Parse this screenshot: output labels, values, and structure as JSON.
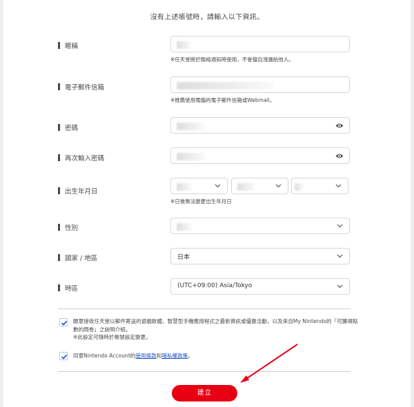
{
  "intro": "沒有上述帳號時，請輸入以下資訊。",
  "fields": {
    "nickname": {
      "label": "暱稱",
      "hint": "※任天堂將於聯絡通知時使用，不會擅自洩漏給他人。"
    },
    "email": {
      "label": "電子郵件信箱",
      "hint": "※推薦使用電腦的電子郵件信箱或Webmail。"
    },
    "password": {
      "label": "密碼"
    },
    "password_confirm": {
      "label": "再次輸入密碼"
    },
    "birthday": {
      "label": "出生年月日",
      "hint": "※日後無法變更出生年月日"
    },
    "gender": {
      "label": "性別"
    },
    "country": {
      "label": "國家 / 地區",
      "value": "日本"
    },
    "timezone": {
      "label": "時區",
      "value": "(UTC+09:00) Asia/Tokyo"
    }
  },
  "consent": {
    "marketing_line1": "願意接收任天堂以郵件寄送的遊戲軟體、智慧型手機應用程式之最新資訊或優惠活動，以及來自My Nintendo的「可獲得點",
    "marketing_line2": "數的問卷」之說明介紹。",
    "marketing_note": "※此設定可隨時於帳號設定變更。",
    "agree_prefix": "同意Nintendo Account的",
    "terms_link": "使用條款",
    "agree_and": "和",
    "privacy_link": "隱私權政策",
    "agree_suffix": "。"
  },
  "submit_label": "建立",
  "colors": {
    "accent": "#e60012",
    "link": "#1a4fc8",
    "checkbox": "#2a5bd7",
    "annotation_arrow": "#e60012"
  }
}
